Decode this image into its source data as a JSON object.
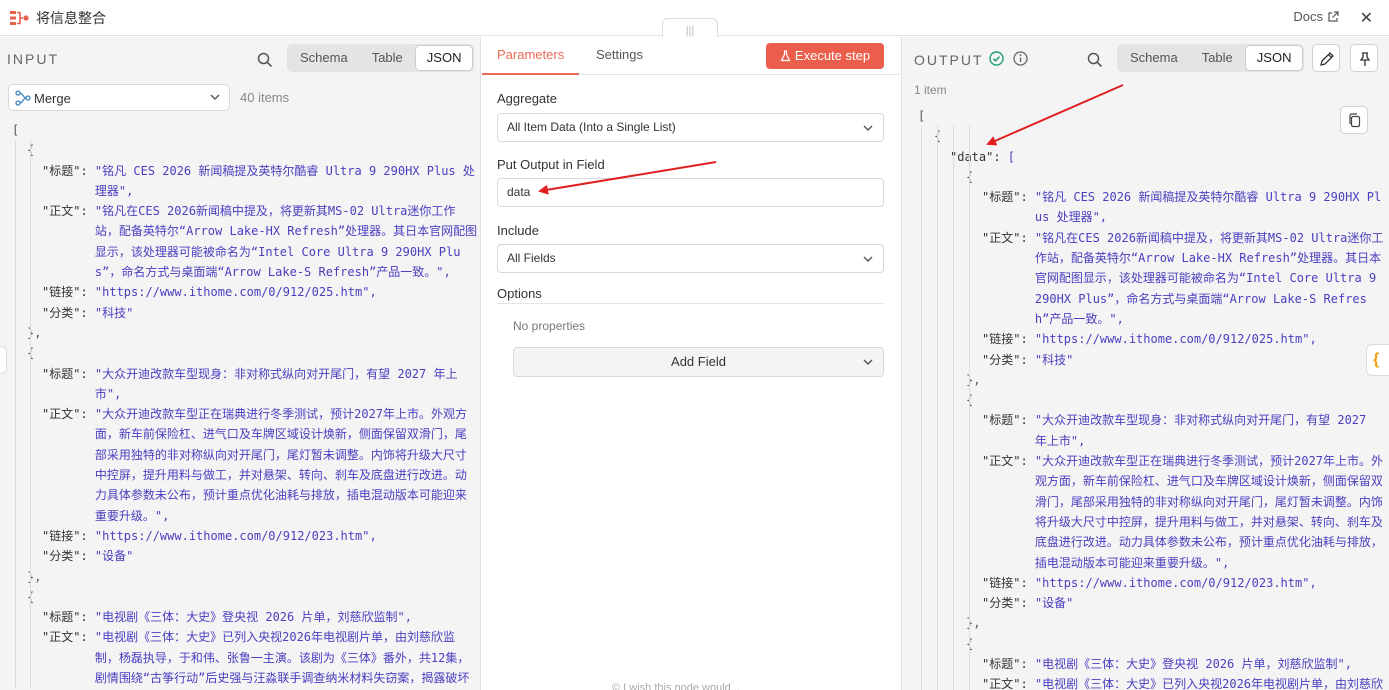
{
  "header": {
    "title": "将信息整合",
    "docs_label": "Docs",
    "close_glyph": "✕",
    "handle_glyph": "|||"
  },
  "input": {
    "section_label": "INPUT",
    "view_tabs": [
      "Schema",
      "Table",
      "JSON"
    ],
    "active_view": "JSON",
    "source_node": "Merge",
    "items_count": "40 items",
    "json_lines": [
      {
        "indent": 0,
        "t": "["
      },
      {
        "indent": 1,
        "t": "{"
      },
      {
        "indent": 2,
        "k": "\"标题\": ",
        "v": "\"铭凡 CES 2026 新闻稿提及英特尔酷睿 Ultra 9 290HX Plus 处理器\","
      },
      {
        "indent": 2,
        "k": "\"正文\": ",
        "v": "\"铭凡在CES 2026新闻稿中提及，将更新其MS-02 Ultra迷你工作站，配备英特尔“Arrow Lake-HX Refresh”处理器。其日本官网配图显示，该处理器可能被命名为“Intel Core Ultra 9 290HX Plus”，命名方式与桌面端“Arrow Lake-S Refresh”产品一致。\","
      },
      {
        "indent": 2,
        "k": "\"链接\": ",
        "v": "\"https://www.ithome.com/0/912/025.htm\","
      },
      {
        "indent": 2,
        "k": "\"分类\": ",
        "v": "\"科技\""
      },
      {
        "indent": 1,
        "t": "},"
      },
      {
        "indent": 1,
        "t": "{"
      },
      {
        "indent": 2,
        "k": "\"标题\": ",
        "v": "\"大众开迪改款车型现身：非对称式纵向对开尾门，有望 2027 年上市\","
      },
      {
        "indent": 2,
        "k": "\"正文\": ",
        "v": "\"大众开迪改款车型正在瑞典进行冬季测试，预计2027年上市。外观方面，新车前保险杠、进气口及车牌区域设计焕新，侧面保留双滑门，尾部采用独特的非对称纵向对开尾门，尾灯暂未调整。内饰将升级大尺寸中控屏，提升用料与做工，并对悬架、转向、刹车及底盘进行改进。动力具体参数未公布，预计重点优化油耗与排放，插电混动版本可能迎来重要升级。\","
      },
      {
        "indent": 2,
        "k": "\"链接\": ",
        "v": "\"https://www.ithome.com/0/912/023.htm\","
      },
      {
        "indent": 2,
        "k": "\"分类\": ",
        "v": "\"设备\""
      },
      {
        "indent": 1,
        "t": "},"
      },
      {
        "indent": 1,
        "t": "{"
      },
      {
        "indent": 2,
        "k": "\"标题\": ",
        "v": "\"电视剧《三体：大史》登央视 2026 片单，刘慈欣监制\","
      },
      {
        "indent": 2,
        "k": "\"正文\": ",
        "v": "\"电视剧《三体：大史》已列入央视2026年电视剧片单，由刘慈欣监制，杨磊执导，于和伟、张鲁一主演。该剧为《三体》番外，共12集，剧情围绕“古筝行动”后史强与汪淼联手调查纳米材料失窃案，揭露破坏"
      }
    ]
  },
  "parameters": {
    "tabs": [
      "Parameters",
      "Settings"
    ],
    "active_tab": "Parameters",
    "execute_label": "Execute step",
    "aggregate_label": "Aggregate",
    "aggregate_value": "All Item Data (Into a Single List)",
    "put_output_label": "Put Output in Field",
    "put_output_value": "data",
    "include_label": "Include",
    "include_value": "All Fields",
    "options_label": "Options",
    "no_properties": "No properties",
    "add_field_label": "Add Field",
    "bottom_hint": "© I wish this node would..."
  },
  "output": {
    "section_label": "OUTPUT",
    "view_tabs": [
      "Schema",
      "Table",
      "JSON"
    ],
    "active_view": "JSON",
    "items_count": "1 item",
    "status_color": "#22a06b",
    "json_lines": [
      {
        "indent": 0,
        "t": "["
      },
      {
        "indent": 1,
        "t": "{"
      },
      {
        "indent": 2,
        "k": "\"data\": ",
        "v": "["
      },
      {
        "indent": 3,
        "t": "{"
      },
      {
        "indent": 4,
        "k": "\"标题\": ",
        "v": "\"铭凡 CES 2026 新闻稿提及英特尔酷睿 Ultra 9 290HX Plus 处理器\","
      },
      {
        "indent": 4,
        "k": "\"正文\": ",
        "v": "\"铭凡在CES 2026新闻稿中提及，将更新其MS-02 Ultra迷你工作站，配备英特尔“Arrow Lake-HX Refresh”处理器。其日本官网配图显示，该处理器可能被命名为“Intel Core Ultra 9 290HX Plus”，命名方式与桌面端“Arrow Lake-S Refresh”产品一致。\","
      },
      {
        "indent": 4,
        "k": "\"链接\": ",
        "v": "\"https://www.ithome.com/0/912/025.htm\","
      },
      {
        "indent": 4,
        "k": "\"分类\": ",
        "v": "\"科技\""
      },
      {
        "indent": 3,
        "t": "},"
      },
      {
        "indent": 3,
        "t": "{"
      },
      {
        "indent": 4,
        "k": "\"标题\": ",
        "v": "\"大众开迪改款车型现身：非对称式纵向对开尾门，有望 2027 年上市\","
      },
      {
        "indent": 4,
        "k": "\"正文\": ",
        "v": "\"大众开迪改款车型正在瑞典进行冬季测试，预计2027年上市。外观方面，新车前保险杠、进气口及车牌区域设计焕新，侧面保留双滑门，尾部采用独特的非对称纵向对开尾门，尾灯暂未调整。内饰将升级大尺寸中控屏，提升用料与做工，并对悬架、转向、刹车及底盘进行改进。动力具体参数未公布，预计重点优化油耗与排放，插电混动版本可能迎来重要升级。\","
      },
      {
        "indent": 4,
        "k": "\"链接\": ",
        "v": "\"https://www.ithome.com/0/912/023.htm\","
      },
      {
        "indent": 4,
        "k": "\"分类\": ",
        "v": "\"设备\""
      },
      {
        "indent": 3,
        "t": "},"
      },
      {
        "indent": 3,
        "t": "{"
      },
      {
        "indent": 4,
        "k": "\"标题\": ",
        "v": "\"电视剧《三体：大史》登央视 2026 片单，刘慈欣监制\","
      },
      {
        "indent": 4,
        "k": "\"正文\": ",
        "v": "\"电视剧《三体：大史》已列入央视2026年电视剧片单，由刘慈欣"
      }
    ]
  },
  "colors": {
    "accent": "#ea6a57",
    "execute": "#eb5e4c",
    "json_value": "#4a3fbf",
    "annotation_arrow": "#e02020"
  }
}
